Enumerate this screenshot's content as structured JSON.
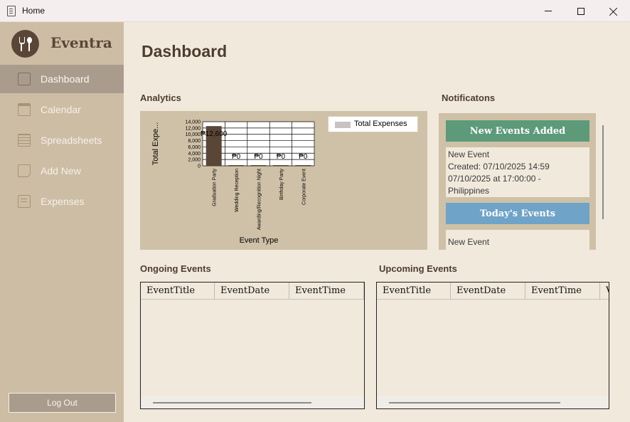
{
  "window": {
    "title": "Home"
  },
  "sidebar": {
    "brand": "Eventra",
    "items": [
      {
        "label": "Dashboard",
        "active": true
      },
      {
        "label": "Calendar"
      },
      {
        "label": "Spreadsheets"
      },
      {
        "label": "Add New"
      },
      {
        "label": "Expenses"
      }
    ],
    "logout_label": "Log Out"
  },
  "main": {
    "title": "Dashboard",
    "analytics_label": "Analytics",
    "notifications_label": "Notificatons",
    "ongoing_label": "Ongoing Events",
    "upcoming_label": "Upcoming Events"
  },
  "notifications": {
    "new_events_header": "New Events Added",
    "new_event_lines": [
      "New Event",
      "Created: 07/10/2025 14:59",
      "07/10/2025 at 17:00:00 -",
      "Philippines"
    ],
    "todays_events_header": "Today's Events",
    "today_event_lines": [
      "New Event"
    ]
  },
  "tables": {
    "ongoing": {
      "columns": [
        "EventTitle",
        "EventDate",
        "EventTime"
      ],
      "rows": []
    },
    "upcoming": {
      "columns": [
        "EventTitle",
        "EventDate",
        "EventTime",
        "V"
      ],
      "rows": []
    }
  },
  "chart_data": {
    "type": "bar",
    "categories": [
      "Graduation Party",
      "Wedding Reception",
      "Awarding/Recognition Night",
      "Birthday Party",
      "Corporate Event"
    ],
    "series": [
      {
        "name": "Total Expenses",
        "values": [
          12600,
          0,
          0,
          0,
          0
        ],
        "data_labels": [
          "₱12,600",
          "₱0",
          "₱0",
          "₱0",
          "₱0"
        ]
      }
    ],
    "yticks": [
      "0",
      "2,000",
      "4,000",
      "6,000",
      "8,000",
      "10,000",
      "12,000",
      "14,000"
    ],
    "ylim": [
      0,
      14000
    ],
    "xlabel": "Event Type",
    "ylabel": "Total Expe...",
    "legend": "top-right",
    "grid": true,
    "colors": {
      "bar": "#5a4637",
      "legend_swatch": "#c6c3c0"
    }
  }
}
